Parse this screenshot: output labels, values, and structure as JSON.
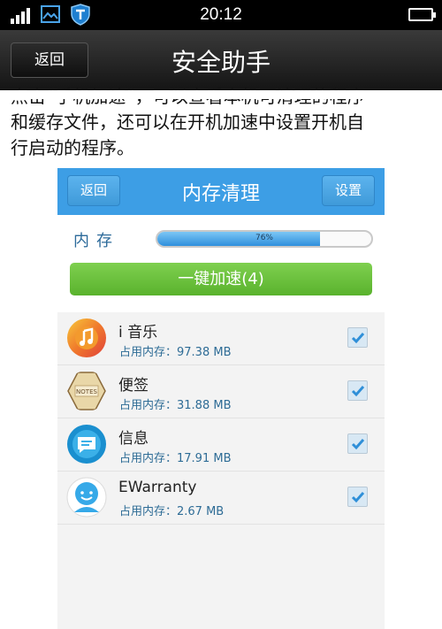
{
  "status_bar": {
    "time": "20:12"
  },
  "header": {
    "back_label": "返回",
    "title": "安全助手"
  },
  "intro": {
    "line1": "点击“手机加速”，可以查看本机可清理的程序",
    "line2": "和缓存文件，还可以在开机加速中设置开机自",
    "line3": "行启动的程序。"
  },
  "phone": {
    "back_label": "返回",
    "title": "内存清理",
    "settings_label": "设置",
    "memory_label": "内存",
    "memory_percent_text": "76%",
    "memory_percent": 0.76,
    "boost_button": "一键加速(4)",
    "apps": [
      {
        "name": "i 音乐",
        "memory": "占用内存：97.38 MB",
        "checked": true,
        "icon": "music-icon"
      },
      {
        "name": "便签",
        "memory": "占用内存：31.88 MB",
        "checked": true,
        "icon": "notes-icon"
      },
      {
        "name": "信息",
        "memory": "占用内存：17.91 MB",
        "checked": true,
        "icon": "message-icon"
      },
      {
        "name": "EWarranty",
        "memory": "占用内存：2.67 MB",
        "checked": true,
        "icon": "ewarranty-icon"
      }
    ]
  },
  "colors": {
    "accent": "#3d9ee5",
    "boost": "#6cc240",
    "progress": "#2e8fdc"
  }
}
